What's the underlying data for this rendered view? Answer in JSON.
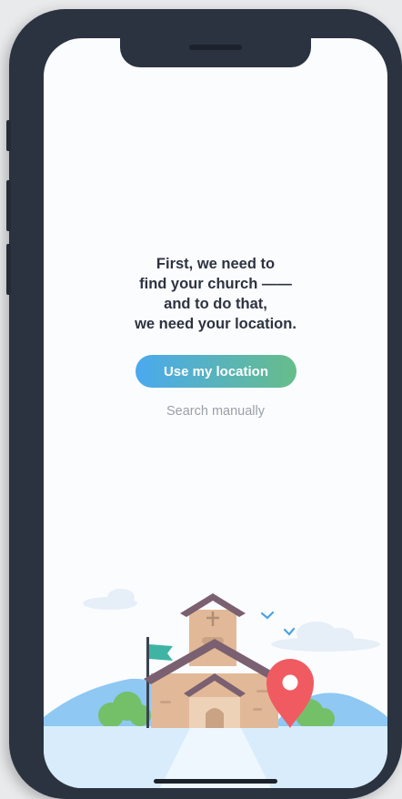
{
  "onboarding": {
    "headline_lines": [
      "First, we need to",
      "find your church ——",
      "and to do that,",
      "we need your location."
    ],
    "primary_button": "Use my location",
    "secondary_link": "Search manually"
  },
  "colors": {
    "gradient_start": "#4aa9ef",
    "gradient_end": "#66bd8a",
    "headline": "#2d3340",
    "link": "#9aa0a8",
    "pin": "#f05b62",
    "phone_frame": "#2b3340"
  },
  "illustration": {
    "icons": [
      "cloud-icon",
      "church-icon",
      "flag-icon",
      "location-pin-icon",
      "bird-icon",
      "hill-icon",
      "tree-icon"
    ]
  }
}
